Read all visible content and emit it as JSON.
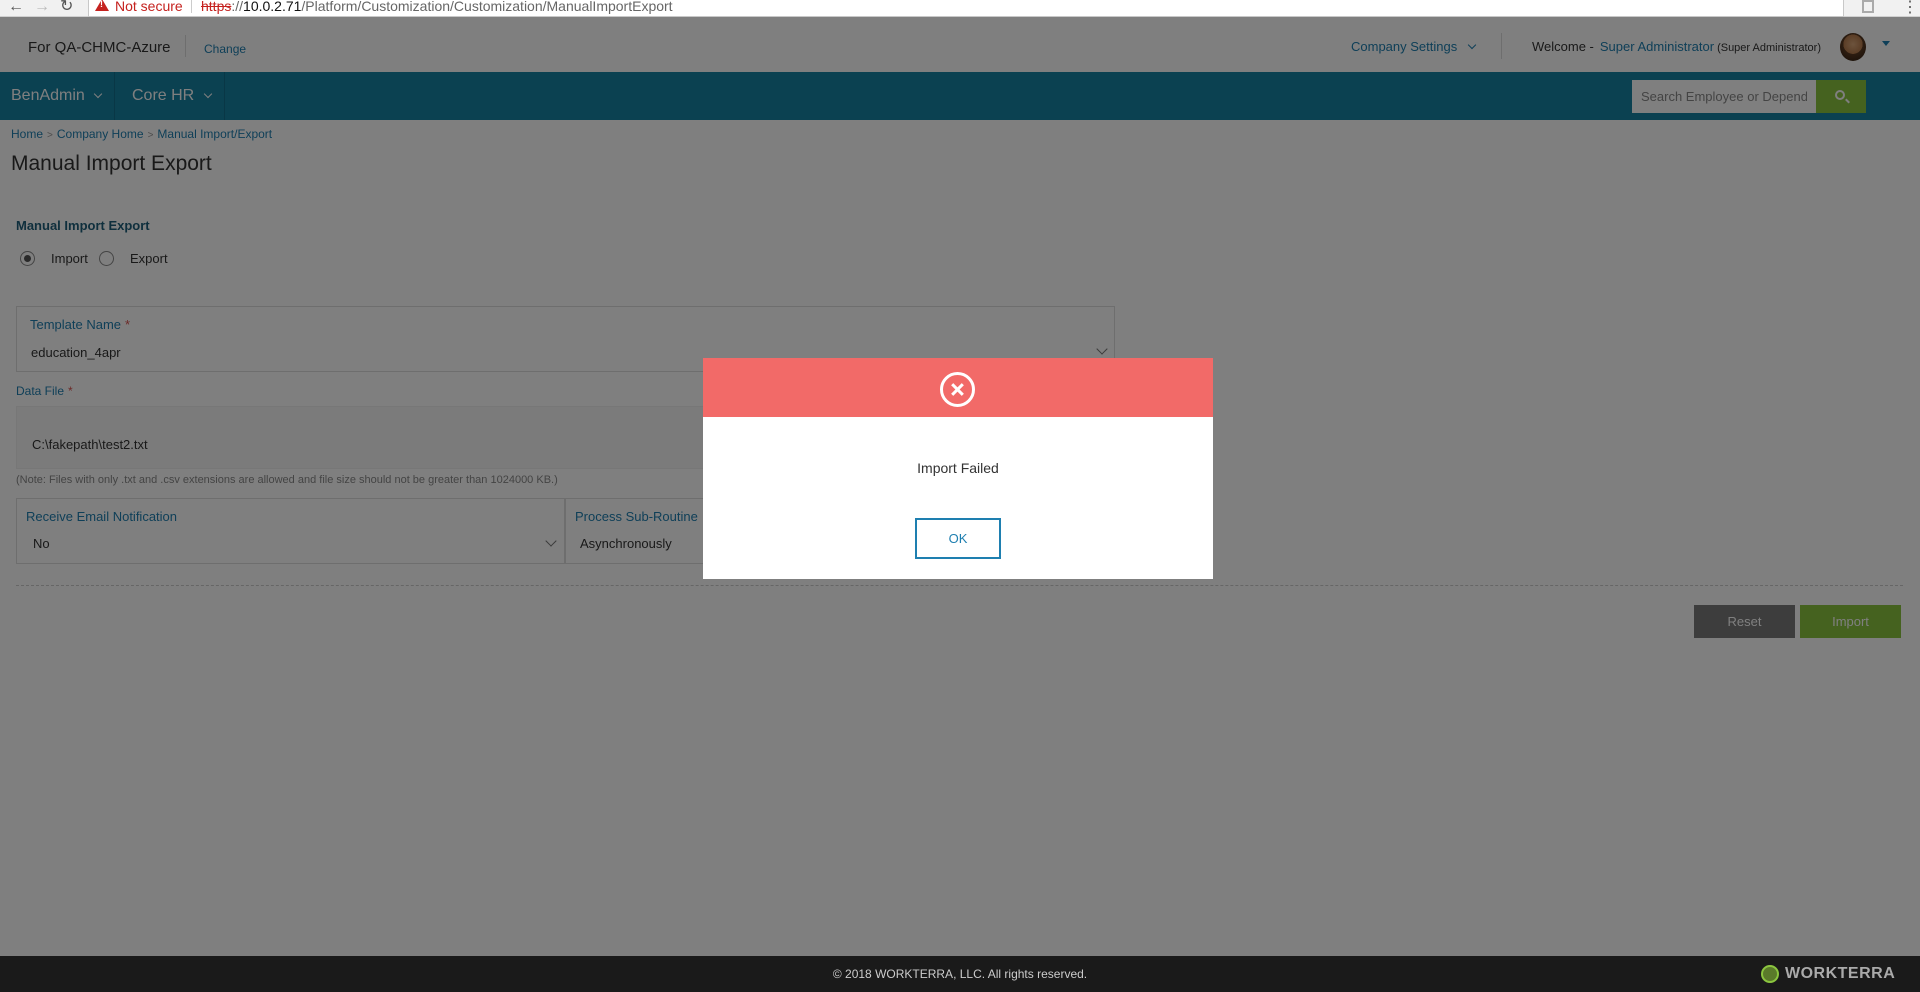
{
  "browser": {
    "security_label": "Not secure",
    "url_scheme": "https",
    "url_host": "10.0.2.71",
    "url_path": "/Platform/Customization/Customization/ManualImportExport"
  },
  "header": {
    "company": "For QA-CHMC-Azure",
    "change_label": "Change",
    "company_settings": "Company Settings",
    "welcome": "Welcome -",
    "user_name": "Super Administrator",
    "user_role": "(Super Administrator)"
  },
  "nav": {
    "items": [
      {
        "label": "BenAdmin"
      },
      {
        "label": "Core HR"
      }
    ],
    "search_placeholder": "Search Employee or Dependent"
  },
  "breadcrumb": {
    "items": [
      "Home",
      "Company Home",
      "Manual Import/Export"
    ]
  },
  "page": {
    "title": "Manual Import Export"
  },
  "form": {
    "section_title": "Manual Import Export",
    "mode_options": [
      {
        "label": "Import",
        "checked": true
      },
      {
        "label": "Export",
        "checked": false
      }
    ],
    "template_label": "Template Name",
    "template_value": "education_4apr",
    "datafile_label": "Data File",
    "datafile_value": "C:\\fakepath\\test2.txt",
    "note": "(Note: Files with only .txt and .csv extensions are allowed and file size should not be greater than 1024000 KB.)",
    "email_label": "Receive Email Notification",
    "email_value": "No",
    "process_label": "Process Sub-Routine",
    "process_value": "Asynchronously",
    "reset_label": "Reset",
    "import_label": "Import"
  },
  "footer": {
    "copyright": "© 2018 WORKTERRA, LLC. All rights reserved.",
    "logo_text": "WORKTERRA"
  },
  "modal": {
    "message": "Import Failed",
    "ok_label": "OK",
    "accent": "#f26a68"
  },
  "colors": {
    "nav": "#1682a3",
    "accent_green": "#8bc53f",
    "link": "#1e7fb0"
  }
}
